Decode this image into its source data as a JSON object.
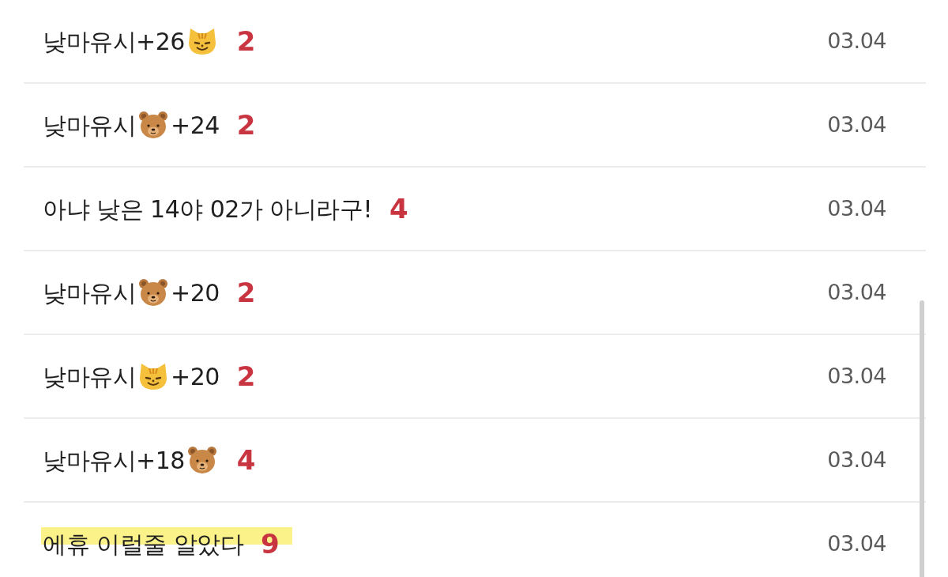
{
  "posts": [
    {
      "title": [
        {
          "kind": "text",
          "text": "낮마유시+26"
        },
        {
          "kind": "cat"
        }
      ],
      "comments": "2",
      "date": "03.04",
      "highlighted": false
    },
    {
      "title": [
        {
          "kind": "text",
          "text": "낮마유시"
        },
        {
          "kind": "bear"
        },
        {
          "kind": "text",
          "text": "+24"
        }
      ],
      "comments": "2",
      "date": "03.04",
      "highlighted": false
    },
    {
      "title": [
        {
          "kind": "text",
          "text": "아냐 낮은 14야 02가 아니라구!"
        }
      ],
      "comments": "4",
      "date": "03.04",
      "highlighted": false
    },
    {
      "title": [
        {
          "kind": "text",
          "text": "낮마유시"
        },
        {
          "kind": "bear"
        },
        {
          "kind": "text",
          "text": "+20"
        }
      ],
      "comments": "2",
      "date": "03.04",
      "highlighted": false
    },
    {
      "title": [
        {
          "kind": "text",
          "text": "낮마유시"
        },
        {
          "kind": "cat"
        },
        {
          "kind": "text",
          "text": "+20"
        }
      ],
      "comments": "2",
      "date": "03.04",
      "highlighted": false
    },
    {
      "title": [
        {
          "kind": "text",
          "text": "낮마유시+18"
        },
        {
          "kind": "bear"
        }
      ],
      "comments": "4",
      "date": "03.04",
      "highlighted": false
    },
    {
      "title": [
        {
          "kind": "text",
          "text": "에휴 이럴줄 알았다"
        }
      ],
      "comments": "9",
      "date": "03.04",
      "highlighted": true
    }
  ]
}
